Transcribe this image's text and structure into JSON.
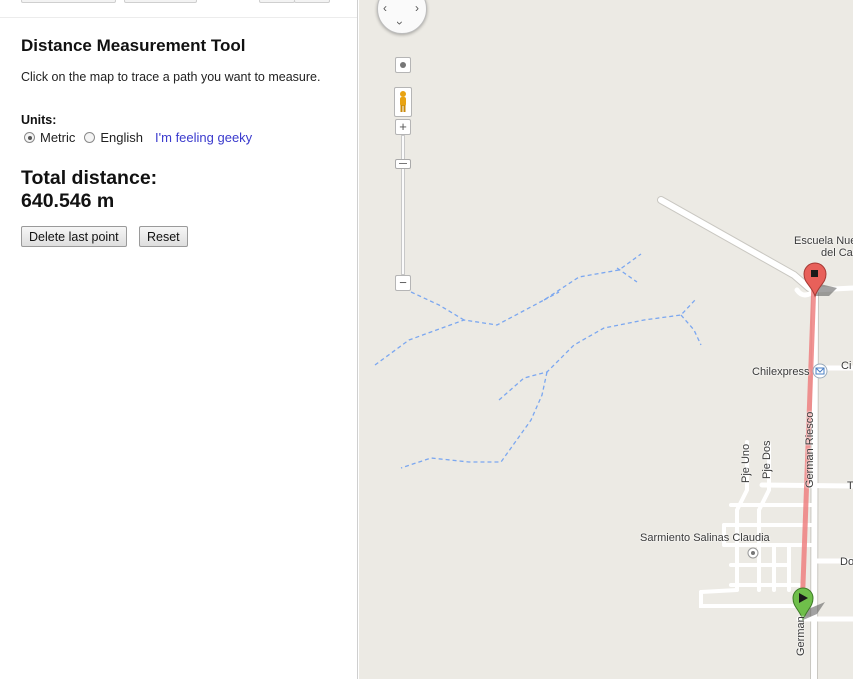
{
  "panel": {
    "title": "Distance Measurement Tool",
    "instructions": "Click on the map to trace a path you want to measure.",
    "units_label": "Units:",
    "units": [
      {
        "label": "Metric",
        "checked": true
      },
      {
        "label": "English",
        "checked": false
      }
    ],
    "geeky_link": "I'm feeling geeky",
    "total_label": "Total distance:",
    "total_value": "640.546 m",
    "buttons": {
      "delete_last": "Delete last point",
      "reset": "Reset"
    }
  },
  "map": {
    "labels": {
      "school_line1": "Escuela Nue",
      "school_line2": "del Ca",
      "chilexpress": "Chilexpress",
      "ci": "Ci",
      "german_riesco": "German Riesco",
      "german_riesco_bottom": "German",
      "pje_uno": "Pje Uno",
      "pje_dos": "Pje Dos",
      "sarmiento": "Sarmiento Salinas Claudia",
      "do": "Do",
      "t": "T"
    },
    "colors": {
      "background": "#eceae4",
      "road": "#ffffff",
      "stream": "#7ba7f0",
      "path": "#ee8080",
      "start_marker": "#6fbf4a",
      "end_marker": "#e8605a"
    },
    "icons": {
      "start": "play-marker-icon",
      "end": "stop-marker-icon",
      "mail": "envelope-icon",
      "poi": "dot-icon",
      "pegman": "pegman-icon"
    }
  }
}
